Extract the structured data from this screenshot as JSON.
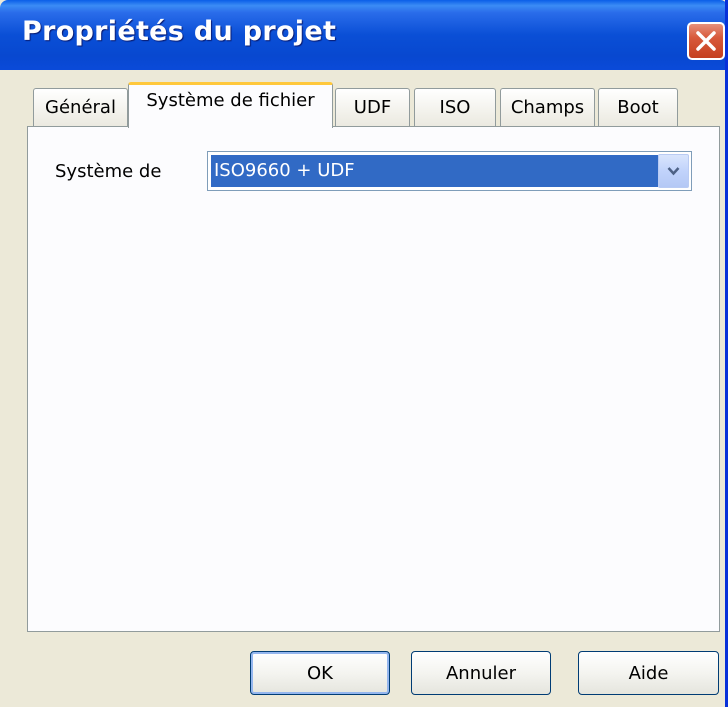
{
  "window": {
    "title": "Propriétés du projet"
  },
  "titlebar": {
    "close_icon": "close-icon"
  },
  "tabs": [
    {
      "label": "Général",
      "active": false
    },
    {
      "label": "Système de fichier",
      "active": true
    },
    {
      "label": "UDF",
      "active": false
    },
    {
      "label": "ISO",
      "active": false
    },
    {
      "label": "Champs",
      "active": false
    },
    {
      "label": "Boot",
      "active": false
    }
  ],
  "filesystem": {
    "label": "Système de",
    "selected_value": "ISO9660 + UDF",
    "dropdown_icon": "chevron-down-icon"
  },
  "buttons": {
    "ok": "OK",
    "cancel": "Annuler",
    "help": "Aide"
  },
  "colors": {
    "titlebar": "#0a4fd6",
    "selection": "#316ac5",
    "active_tab_accent": "#ffc83c",
    "close_button": "#d8593b"
  }
}
